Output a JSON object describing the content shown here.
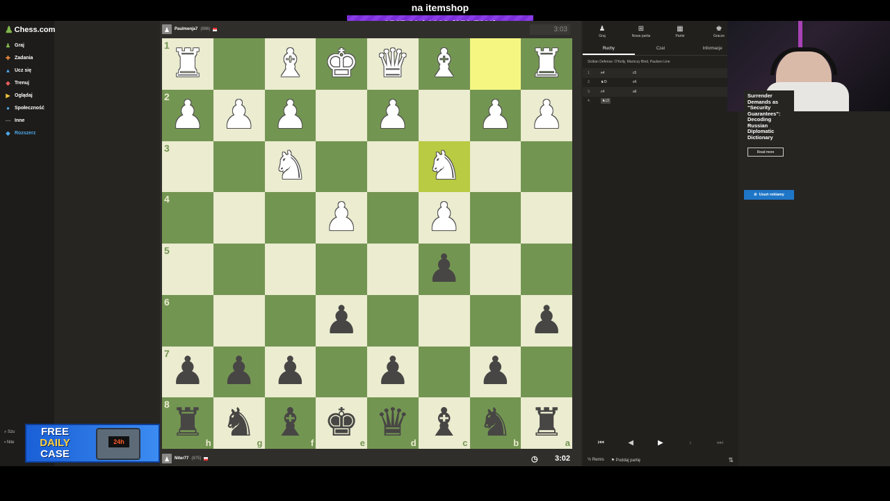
{
  "overlay": {
    "title": "na itemshop",
    "goal": "1547.69 / 1020 (151.73%)"
  },
  "sidebar": {
    "logo": "Chess.com",
    "items": [
      {
        "label": "Graj",
        "icon": "play-icon"
      },
      {
        "label": "Zadania",
        "icon": "puzzle-icon"
      },
      {
        "label": "Ucz się",
        "icon": "learn-icon"
      },
      {
        "label": "Trenuj",
        "icon": "train-icon"
      },
      {
        "label": "Oglądaj",
        "icon": "watch-icon"
      },
      {
        "label": "Społeczność",
        "icon": "community-icon"
      },
      {
        "label": "Inne",
        "icon": "more-icon"
      },
      {
        "label": "Rozszerz",
        "icon": "diamond-icon"
      }
    ],
    "search": "Szu",
    "user": "Nite"
  },
  "top_player": {
    "name": "Paulmenja7",
    "rating": "(886)",
    "clock": "3:03"
  },
  "bottom_player": {
    "name": "Niter77",
    "rating": "(875)",
    "clock": "3:02"
  },
  "board": {
    "ranks": [
      "1",
      "2",
      "3",
      "4",
      "5",
      "6",
      "7",
      "8"
    ],
    "files": [
      "h",
      "g",
      "f",
      "e",
      "d",
      "c",
      "b",
      "a"
    ]
  },
  "panel": {
    "tabs": [
      {
        "label": "Graj",
        "icon": "play-icon"
      },
      {
        "label": "Nowa partia",
        "icon": "new-game-icon"
      },
      {
        "label": "Partie",
        "icon": "games-icon"
      },
      {
        "label": "Gracze",
        "icon": "players-icon"
      }
    ],
    "subtabs": [
      "Ruchy",
      "Czat",
      "Informacje"
    ],
    "opening": "Sicilian Defense: O'Kelly, Maróczy Bind, Paulsen Line",
    "moves": [
      {
        "num": "1.",
        "white": "e4",
        "black": "c5"
      },
      {
        "num": "2.",
        "white": "♞f3",
        "black": "e6"
      },
      {
        "num": "3.",
        "white": "c4",
        "black": "a6"
      },
      {
        "num": "4.",
        "white": "♞c3",
        "black": ""
      }
    ],
    "draw_label": "Remis",
    "resign_label": "Poddaj partię"
  },
  "ad": {
    "headline": "Surrender Demands as “Security Guarantees”: Decoding Russian Diplomatic Dictionary",
    "button": "Read more",
    "remove": "Usuń reklamy"
  },
  "promo": {
    "line1": "FREE",
    "line2": "DAILY",
    "line3": "CASE",
    "badge": "24h"
  }
}
